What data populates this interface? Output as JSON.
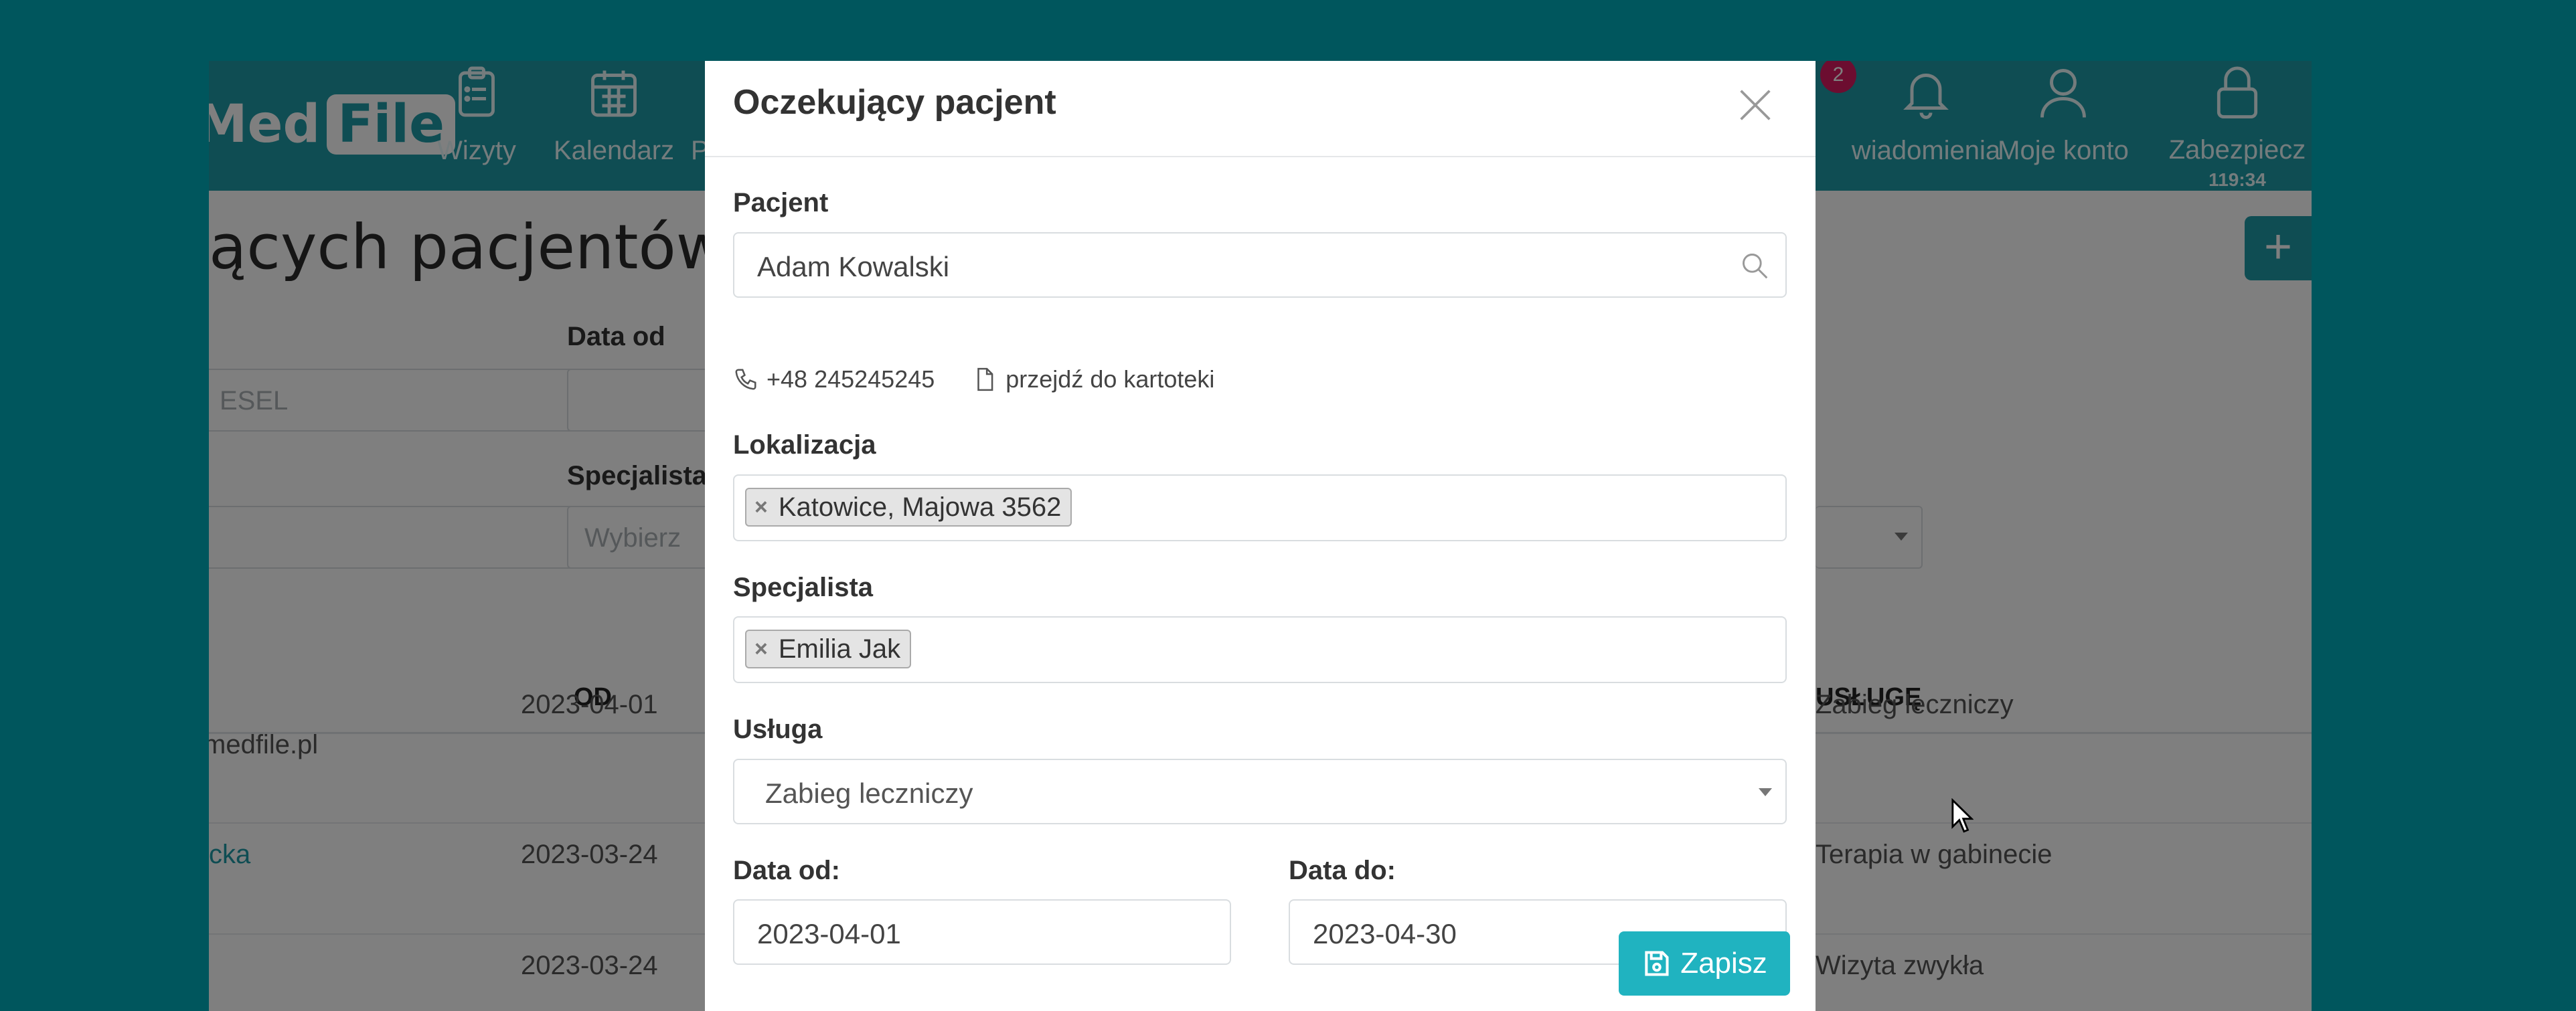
{
  "app": {
    "logo": {
      "part_a": "Med",
      "part_b": "File"
    },
    "nav": [
      {
        "label": "Wizyty",
        "icon": "clipboard-list-icon"
      },
      {
        "label": "Kalendarz",
        "icon": "calendar-icon"
      },
      {
        "label": "P",
        "icon": ""
      },
      {
        "label": "wiadomienia",
        "icon": "bell-icon",
        "badge": "2"
      },
      {
        "label": "Moje konto",
        "icon": "user-icon"
      },
      {
        "label": "Zabezpiecz",
        "icon": "lock-icon",
        "sub": "119:34"
      }
    ],
    "add_button": "+",
    "page_title": "ących pacjentów",
    "filters": {
      "pesel_placeholder": "ESEL",
      "date_from_label": "Data od",
      "specialist_label": "Specjalista",
      "specialist_placeholder": "Wybierz"
    },
    "table": {
      "headers": {
        "from": "OD",
        "service": "USŁUGĘ"
      },
      "rows": [
        {
          "left": "medfile.pl",
          "from": "2023-04-01",
          "service": "Zabieg leczniczy"
        },
        {
          "left": "cka",
          "from": "2023-03-24",
          "service": "Terapia w gabinecie"
        },
        {
          "left": "",
          "from": "2023-03-24",
          "service": "Wizyta zwykła"
        }
      ]
    }
  },
  "modal": {
    "title": "Oczekujący pacjent",
    "patient_label": "Pacjent",
    "patient_value": "Adam Kowalski",
    "phone": "+48 245245245",
    "record_link": "przejdź do kartoteki",
    "location_label": "Lokalizacja",
    "location_chip": "Katowice, Majowa 3562",
    "specialist_label": "Specjalista",
    "specialist_chip": "Emilia Jak",
    "chip_remove": "×",
    "service_label": "Usługa",
    "service_value": "Zabieg leczniczy",
    "date_from_label": "Data od:",
    "date_from_value": "2023-04-01",
    "date_to_label": "Data do:",
    "date_to_value": "2023-04-30",
    "save_label": "Zapisz"
  },
  "colors": {
    "background": "#00adbb",
    "topbar": "#1e9aa6",
    "accent": "#20b3c0",
    "badge": "#d81b60"
  }
}
